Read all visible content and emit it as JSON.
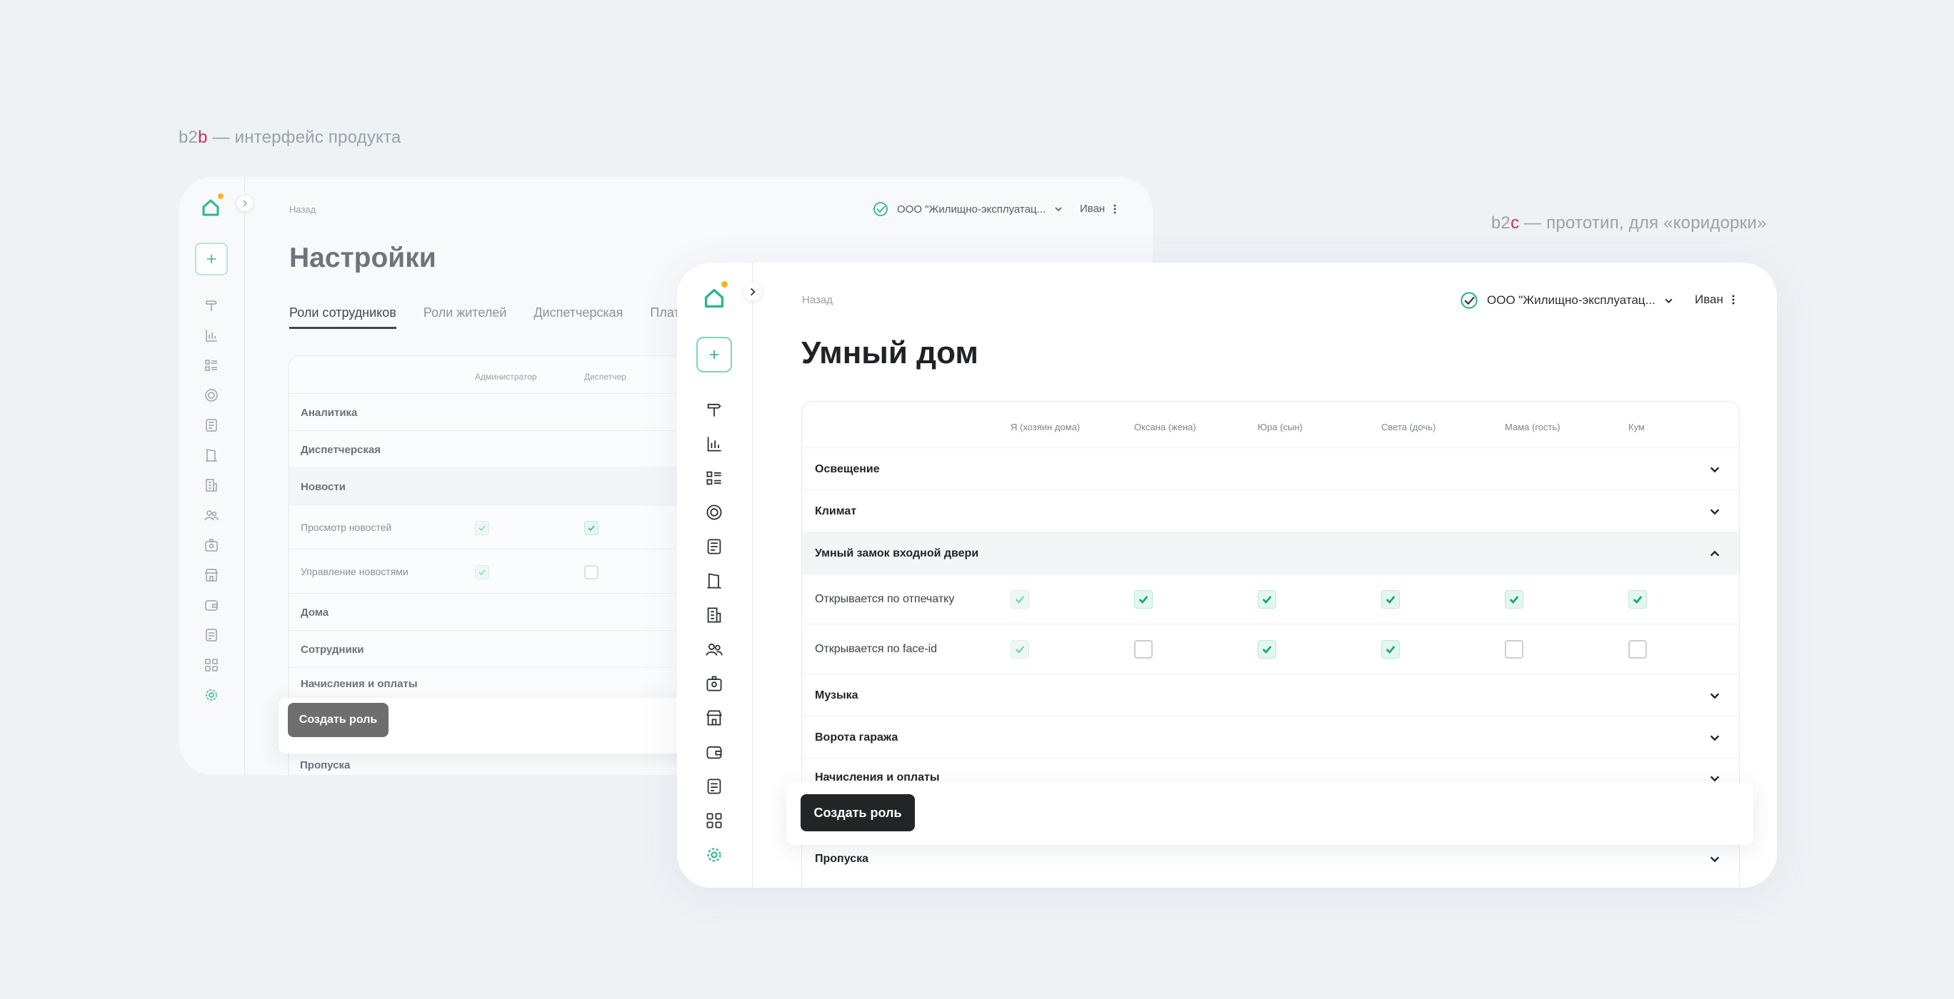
{
  "captions": {
    "b2b": {
      "prefix": "b2",
      "accent": "b",
      "text": " — интерфейс продукта"
    },
    "b2c": {
      "prefix": "b2",
      "accent": "c",
      "text": " — прототип, для «коридорки»"
    }
  },
  "colors": {
    "accent_green": "#2fb888",
    "logo_dot": "#f5b623",
    "caption_accent": "#d6285f",
    "dark_button": "#222426",
    "gray_button": "#6e6e6e"
  },
  "b2b": {
    "back": "Назад",
    "org": "ООО \"Жилищно-эксплуатац...",
    "user": "Иван",
    "title": "Настройки",
    "tabs": [
      "Роли сотрудников",
      "Роли жителей",
      "Диспетчерская",
      "Платежи"
    ],
    "columns": [
      "Администратор",
      "Диспетчер"
    ],
    "rows": [
      "Аналитика",
      "Диспетчерская",
      "Новости",
      "Просмотр новостей",
      "Управление новостями",
      "Дома",
      "Сотрудники",
      "Начисления и оплаты",
      "Пропуска"
    ],
    "create_button": "Создать роль"
  },
  "b2c": {
    "back": "Назад",
    "org": "ООО \"Жилищно-эксплуатац...",
    "user": "Иван",
    "title": "Умный дом",
    "columns": [
      "Я (хозяин дома)",
      "Оксана (жена)",
      "Юра (сын)",
      "Света (дочь)",
      "Мама (гость)",
      "Кум"
    ],
    "sections": [
      "Освещение",
      "Климат",
      "Умный замок входной двери",
      "Музыка",
      "Ворота гаража",
      "Начисления и оплаты",
      "Пропуска"
    ],
    "permissions": [
      {
        "label": "Открывается по отпечатку",
        "values": [
          true,
          true,
          true,
          true,
          true,
          true
        ]
      },
      {
        "label": "Открывается по face-id",
        "values": [
          true,
          false,
          true,
          true,
          false,
          false
        ]
      }
    ],
    "create_button": "Создать роль"
  },
  "sidebar_icons": [
    "home-logo-icon",
    "plus-icon",
    "pin-icon",
    "chart-icon",
    "list-icon",
    "target-icon",
    "news-icon",
    "door-icon",
    "building-icon",
    "users-icon",
    "badge-icon",
    "store-icon",
    "wallet-icon",
    "document-icon",
    "apps-icon",
    "settings-icon"
  ]
}
